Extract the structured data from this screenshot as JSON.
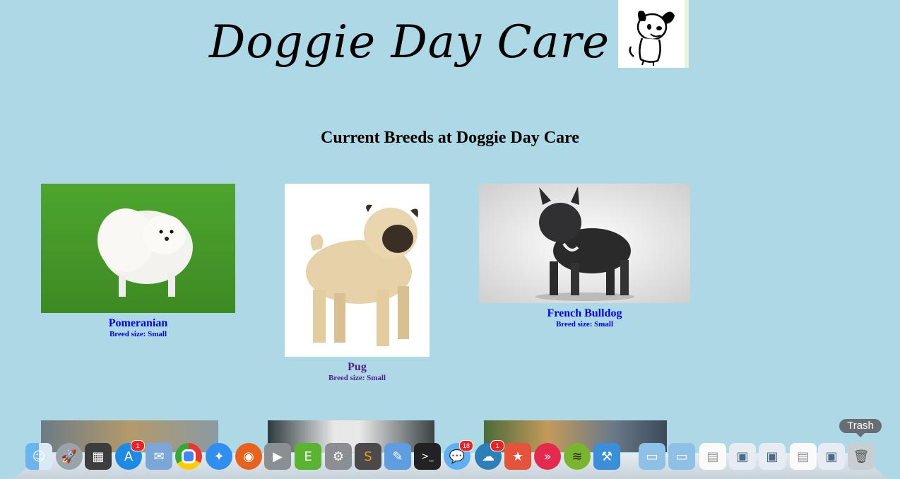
{
  "site": {
    "title": "Doggie Day Care",
    "logo_icon": "cartoon-dog-logo"
  },
  "heading": "Current Breeds at Doggie Day Care",
  "breeds": [
    {
      "name": "Pomeranian",
      "size": "Breed size: Small"
    },
    {
      "name": "Pug",
      "size": "Breed size: Small"
    },
    {
      "name": "French Bulldog",
      "size": "Breed size: Small"
    }
  ],
  "dock": {
    "trash_label": "Trash",
    "app_store_badge": "1",
    "messages_badge": "18",
    "chat_badge": "1",
    "items": [
      "finder-icon",
      "launchpad-icon",
      "mission-control-icon",
      "app-store-icon",
      "mail-icon",
      "chrome-icon",
      "safari-icon",
      "firefox-icon",
      "facetime-icon",
      "evernote-icon",
      "system-preferences-icon",
      "sublime-text-icon",
      "xcode-icon",
      "terminal-icon",
      "messages-icon",
      "chat-icon",
      "wunderlist-icon",
      "pocket-icon",
      "spotify-icon",
      "instruments-icon",
      "folder-icon",
      "folder-icon",
      "document-icon",
      "window-icon",
      "window-icon",
      "document-icon",
      "window-icon",
      "trash-icon"
    ]
  }
}
